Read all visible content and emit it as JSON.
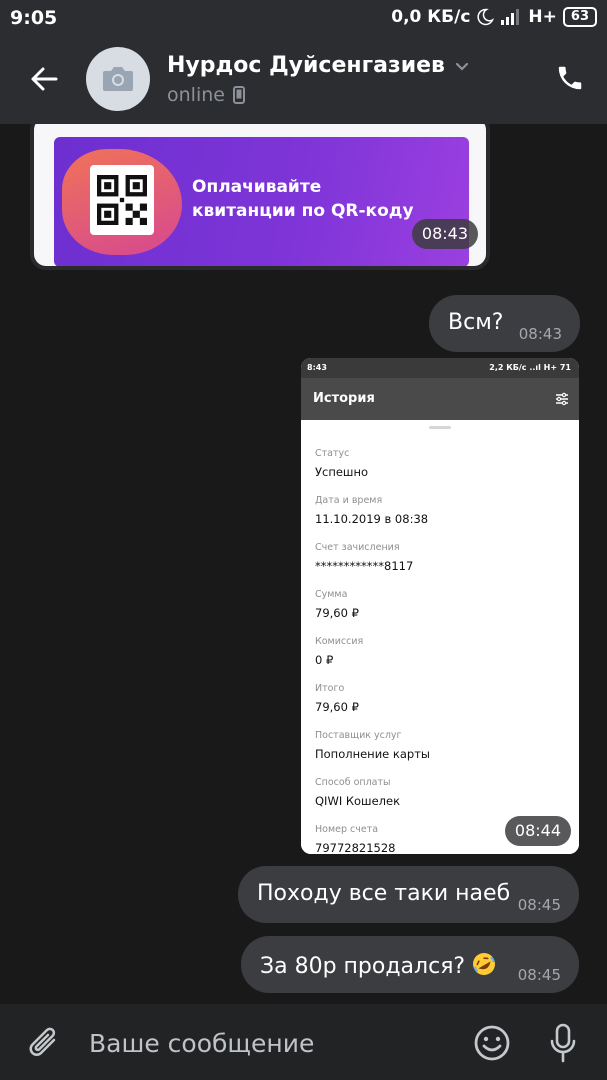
{
  "status_bar": {
    "time": "9:05",
    "speed": "0,0 КБ/с",
    "network": "H+",
    "battery": "63"
  },
  "header": {
    "contact_name": "Нурдос Дуйсенгазиев",
    "contact_status": "online"
  },
  "messages": {
    "banner": {
      "text_line1": "Оплачивайте",
      "text_line2": "квитанции по QR-коду",
      "time": "08:43"
    },
    "bubble1": {
      "text": "Всм?",
      "time": "08:43"
    },
    "screenshot": {
      "time": "08:44",
      "status_time": "8:43",
      "status_right": "2,2 КБ/с ..ıl H+ 71",
      "title": "История",
      "rows": [
        {
          "label": "Статус",
          "value": "Успешно"
        },
        {
          "label": "Дата и время",
          "value": "11.10.2019 в 08:38"
        },
        {
          "label": "Счет зачисления",
          "value": "************8117"
        },
        {
          "label": "Сумма",
          "value": "79,60 ₽"
        },
        {
          "label": "Комиссия",
          "value": "0 ₽"
        },
        {
          "label": "Итого",
          "value": "79,60 ₽"
        },
        {
          "label": "Поставщик услуг",
          "value": "Пополнение карты"
        },
        {
          "label": "Способ оплаты",
          "value": "QIWI Кошелек"
        },
        {
          "label": "Номер счета",
          "value": "79772821528"
        }
      ]
    },
    "bubble3": {
      "text": "Походу все таки наеб",
      "time": "08:45"
    },
    "bubble4": {
      "text": "За 80р продался?",
      "time": "08:45",
      "emoji": "rolling-on-floor-laughing-emoji"
    }
  },
  "input": {
    "placeholder": "Ваше сообщение"
  },
  "colors": {
    "background": "#19191a",
    "header": "#2b2d30",
    "bubble": "#3c3d40",
    "banner_purple": "#7f35d8"
  }
}
